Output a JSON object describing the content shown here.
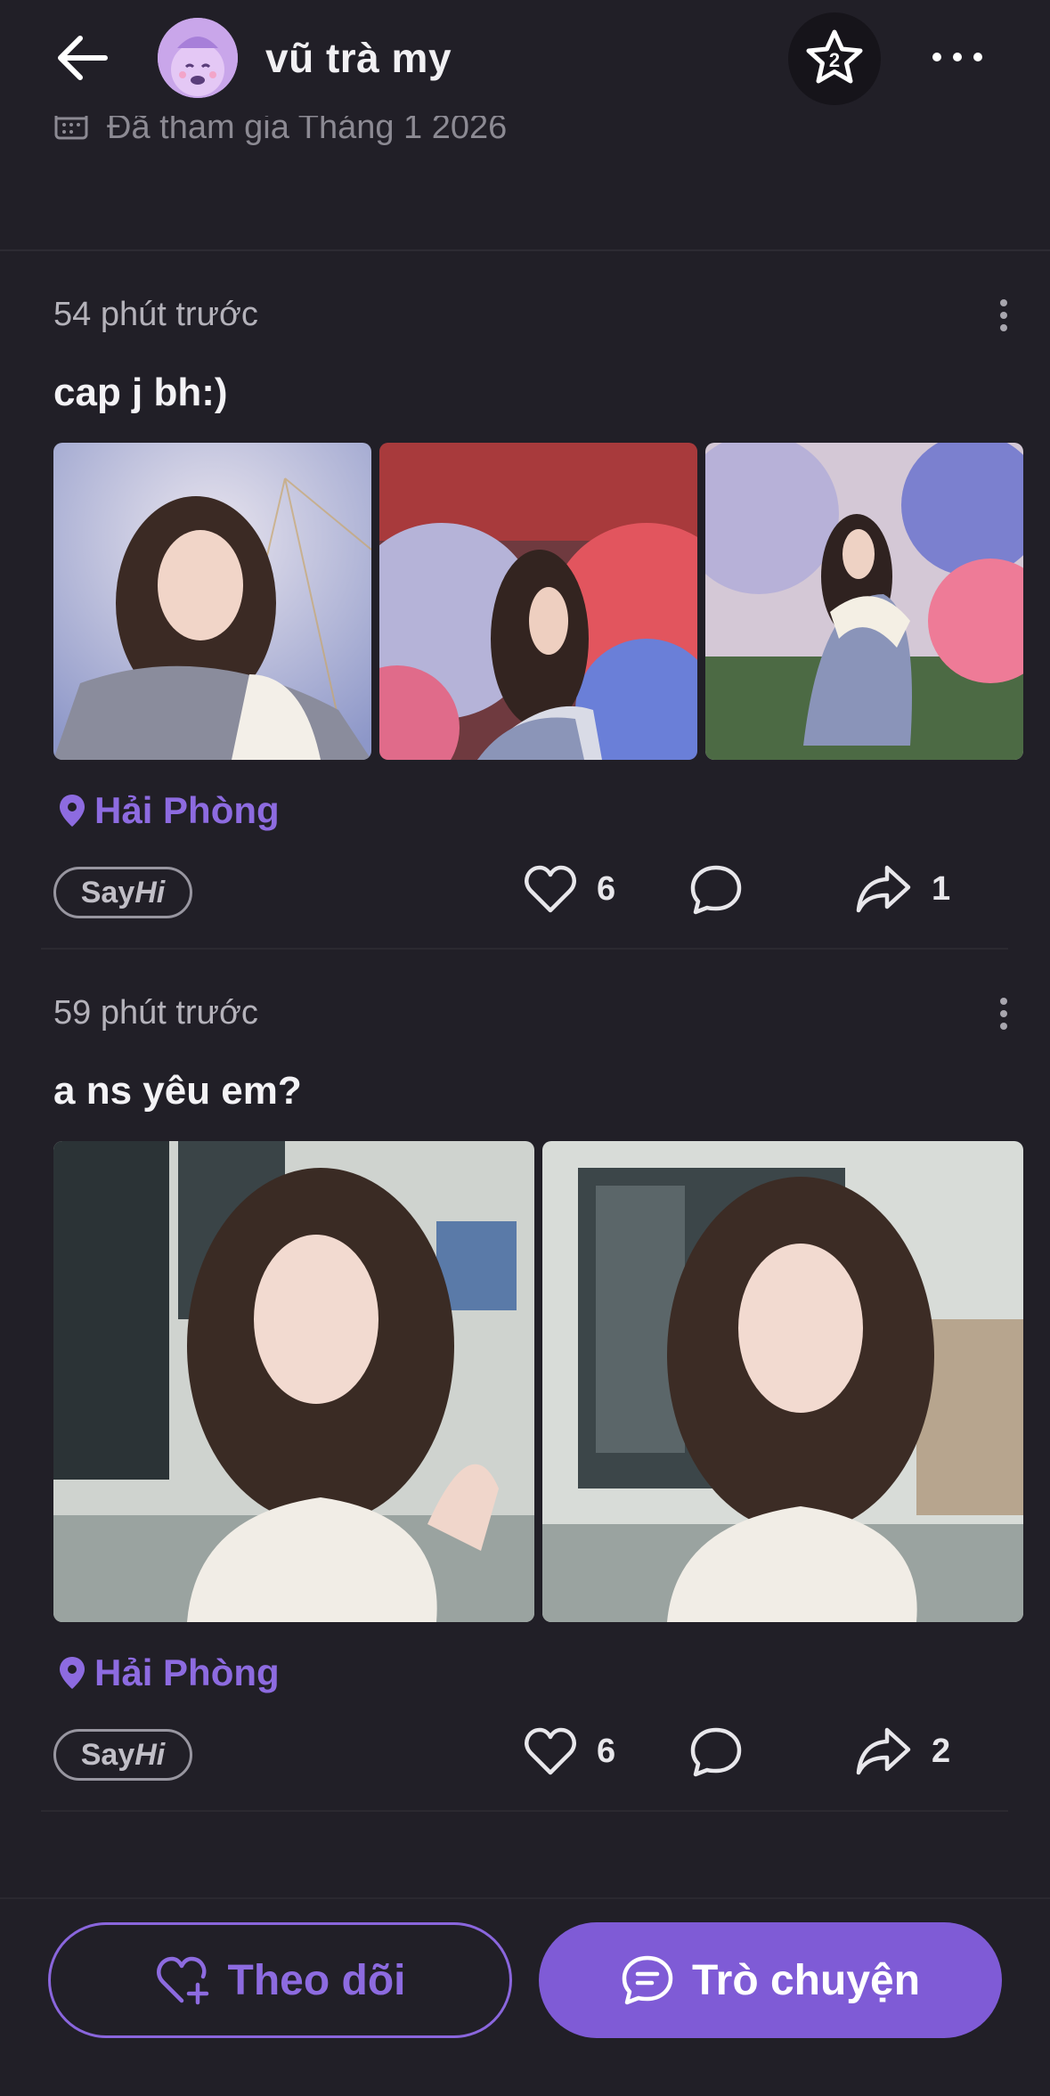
{
  "header": {
    "name": "vũ trà my",
    "badge_number": "2"
  },
  "profile": {
    "joined_text": "Đã tham gia Tháng 1 2026"
  },
  "posts": [
    {
      "time": "54 phút trước",
      "text": "cap j bh:)",
      "location": "Hải Phòng",
      "sayhi_say": "Say",
      "sayhi_hi": "Hi",
      "likes": "6",
      "shares": "1"
    },
    {
      "time": "59 phút trước",
      "text": "a ns yêu em?",
      "location": "Hải Phòng",
      "sayhi_say": "Say",
      "sayhi_hi": "Hi",
      "likes": "6",
      "shares": "2"
    }
  ],
  "footer": {
    "follow_label": "Theo dõi",
    "chat_label": "Trò chuyện"
  },
  "colors": {
    "background": "#211f27",
    "accent": "#7f5bd6",
    "accent_text": "#8d6be0"
  }
}
